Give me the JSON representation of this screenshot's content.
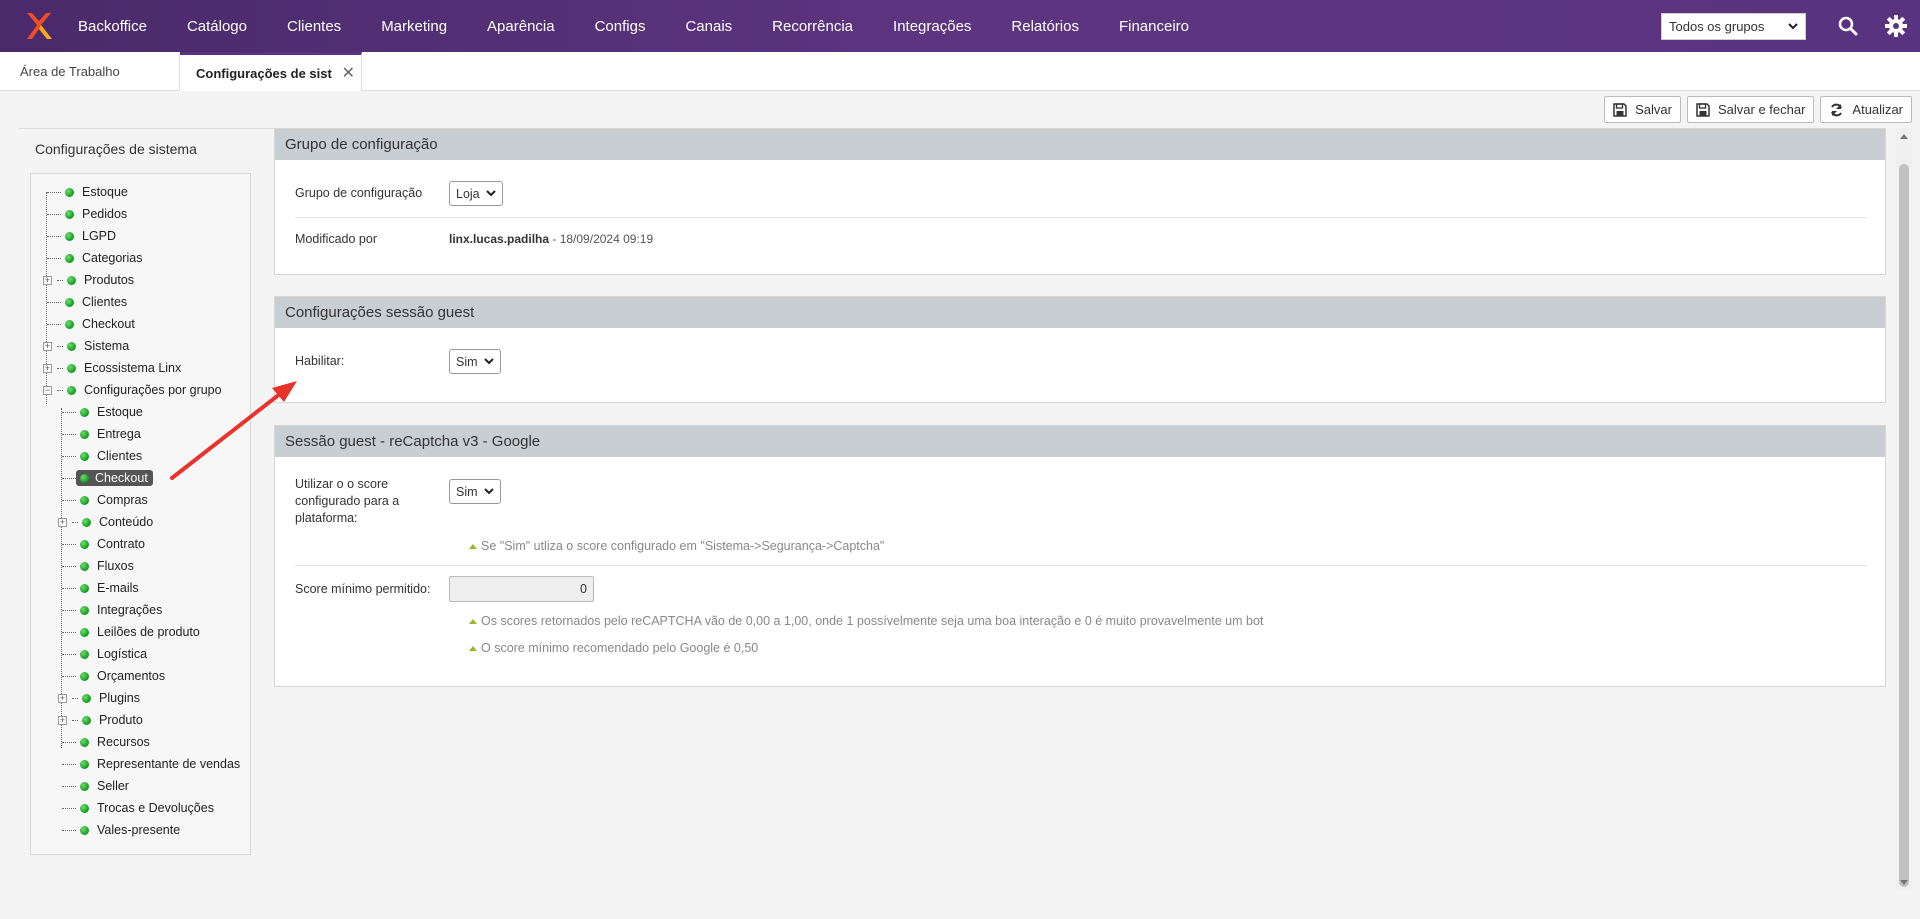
{
  "topnav": {
    "menu": [
      "Backoffice",
      "Catálogo",
      "Clientes",
      "Marketing",
      "Aparência",
      "Configs",
      "Canais",
      "Recorrência",
      "Integrações",
      "Relatórios",
      "Financeiro"
    ],
    "group_select": "Todos os grupos",
    "brand_color": "#5a3380"
  },
  "tabs": {
    "desktop": "Área de Trabalho",
    "active": "Configurações de sistema",
    "close": "✕"
  },
  "toolbar": {
    "save": "Salvar",
    "save_close": "Salvar e fechar",
    "refresh": "Atualizar"
  },
  "leftpanel": {
    "title": "Configurações de sistema",
    "root_items": [
      "Estoque",
      "Pedidos",
      "LGPD",
      "Categorias",
      "Produtos",
      "Clientes",
      "Checkout",
      "Sistema",
      "Ecossistema Linx",
      "Configurações por grupo"
    ],
    "group_items": [
      "Estoque",
      "Entrega",
      "Clientes",
      "Checkout",
      "Compras",
      "Conteúdo",
      "Contrato",
      "Fluxos",
      "E-mails",
      "Integrações",
      "Leilões de produto",
      "Logística",
      "Orçamentos",
      "Plugins",
      "Produto",
      "Recursos",
      "Representante de vendas",
      "Seller",
      "Trocas e Devoluções",
      "Vales-presente"
    ],
    "selected": "Checkout"
  },
  "sections": {
    "group": {
      "title": "Grupo de configuração",
      "group_label": "Grupo de configuração",
      "group_value": "Loja",
      "modified_label": "Modificado por",
      "modified_user": "linx.lucas.padilha",
      "modified_date": "- 18/09/2024 09:19"
    },
    "guest": {
      "title": "Configurações sessão guest",
      "enable_label": "Habilitar:",
      "enable_value": "Sim"
    },
    "recaptcha": {
      "title": "Sessão guest - reCaptcha v3 - Google",
      "use_score_label": "Utilizar o o score configurado para a plataforma:",
      "use_score_value": "Sim",
      "use_score_hint": "Se \"Sim\" utliza o score configurado em \"Sistema->Segurança->Captcha\"",
      "min_score_label": "Score mínimo permitido:",
      "min_score_value": "0",
      "hint1": "Os scores retornados pelo reCAPTCHA vão de 0,00 a 1,00, onde 1 possívelmente seja uma boa interação e 0 é muito provavelmente um bot",
      "hint2": "O score mínimo recomendado pelo Google é 0,50"
    }
  }
}
